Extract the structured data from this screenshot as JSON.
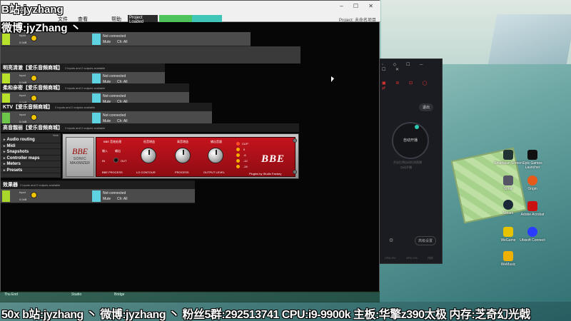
{
  "overlay": {
    "line1": "B站:jyzhang",
    "line2": "微博:jyZhang 丶"
  },
  "daw": {
    "menus": [
      "文件",
      "查看",
      "帮助"
    ],
    "status": [
      "Project Loaded",
      "",
      ""
    ],
    "window_controls": "– ☐ ✕",
    "project_label": "Project: 未命名项目"
  },
  "racks": [
    {
      "title": "明亮清澈【爱乐音频商城】",
      "conn": "Not connected",
      "mute": "Mute",
      "ch": "Ch: All",
      "input": "Input",
      "gain": "0.0dB",
      "sub": "2 inputs and 2 outputs available"
    },
    {
      "title": "柔和亲密【爱乐音频商城】",
      "conn": "Not connected",
      "mute": "Mute",
      "ch": "Ch: All",
      "input": "Input",
      "gain": "0.0dB",
      "sub": "2 inputs and 2 outputs available"
    },
    {
      "title": "KTV【爱乐音频商城】",
      "conn": "Not connected",
      "mute": "Mute",
      "ch": "Ch: All",
      "input": "Input",
      "gain": "0.0dB",
      "sub": "2 inputs and 2 outputs available"
    },
    {
      "title": "高音靓丽【爱乐音频商城】",
      "conn": "Not connected",
      "mute": "Mute",
      "ch": "Ch: All",
      "input": "Input",
      "gain": "0.0dB",
      "sub": "2 inputs and 2 outputs available"
    },
    {
      "title": "效果器",
      "conn": "Not connected",
      "mute": "Mute",
      "ch": "Ch: All",
      "input": "Input",
      "gain": "0.0dB",
      "sub": "2 inputs and 2 outputs available"
    }
  ],
  "first_strip": {
    "conn": "Not connected",
    "mute": "Mute",
    "ch": "Ch: All",
    "input": "Input",
    "gain": "0.0dB"
  },
  "sidebar": {
    "hide_label": "Hide",
    "items": [
      "Audio routing",
      "Midi",
      "Snapshots",
      "Controller maps",
      "Meters",
      "Presets"
    ]
  },
  "bbe": {
    "title": "BBE 音效处理",
    "logo_small": "BBE",
    "sonic": "SONIC",
    "maximizer": "MAXIMIZER",
    "process_label": "BBE PROCESS",
    "in_label": "IN",
    "out_label": "OUT",
    "in_cn": "输入",
    "out_cn": "输出",
    "knob1_cn": "低音增益",
    "knob2_cn": "高音增益",
    "knob3_cn": "输出音量",
    "knob1": "LO CONTOUR",
    "knob2": "PROCESS",
    "knob3": "OUTPUT LEVEL",
    "brand": "BBE",
    "clip": "CLIP",
    "leds": [
      "0",
      "-6",
      "-12",
      "-24"
    ],
    "footer": "Plugins by Studio Factory",
    "accent": "#c4141e"
  },
  "app": {
    "circle_label": "自动开播",
    "out_button": "退出",
    "muted1": "开启后将自动检测直播",
    "muted2": "自动开播",
    "footer_btn": "高级设置",
    "stat1": "CPU 0%",
    "stat2": "GPU 1%",
    "stat3": "内存"
  },
  "desktop_icons": [
    "Smartisan Screen",
    "Epic Games Launcher",
    "Sonic",
    "Origin",
    "Steam",
    "Adobe Acrobat",
    "WeGame",
    "Ubisoft Connect",
    "WeMusic"
  ],
  "taskbar": [
    "Thu End",
    "Studio",
    "Bridge"
  ],
  "banner": "50x b站:jyzhang 丶 微博:jyzhang 丶 粉丝5群:292513741 CPU:i9-9900k 主板:华擎z390太极 内存:芝奇幻光戟"
}
